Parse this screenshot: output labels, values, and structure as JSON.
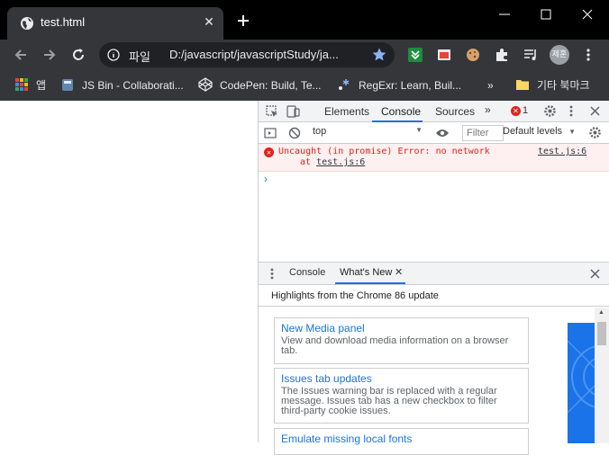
{
  "browser": {
    "tab_title": "test.html",
    "address_scheme": "파일",
    "address_url": "D:/javascript/javascriptStudy/ja...",
    "profile_label": "제훈"
  },
  "bookmarks": [
    {
      "label": "앱",
      "icon": "apps-grid-icon"
    },
    {
      "label": "JS Bin - Collaborati...",
      "icon": "jsbin-icon"
    },
    {
      "label": "CodePen: Build, Te...",
      "icon": "codepen-icon"
    },
    {
      "label": "RegExr: Learn, Buil...",
      "icon": "regexr-icon"
    }
  ],
  "bookmarks_overflow": "»",
  "other_bookmarks": "기타 북마크",
  "devtools": {
    "tabs": [
      "Elements",
      "Console",
      "Sources"
    ],
    "active_tab": "Console",
    "more_tabs": "»",
    "error_count": "1",
    "context": "top",
    "filter_placeholder": "Filter",
    "levels": "Default levels",
    "error": {
      "message": "Uncaught (in promise) Error: no network",
      "at_prefix": "at",
      "location": "test.js:6",
      "source": "test.js:6"
    },
    "prompt": "›",
    "drawer": {
      "tabs": [
        "Console",
        "What's New"
      ],
      "active_tab": "What's New",
      "header": "Highlights from the Chrome 86 update",
      "cards": [
        {
          "title": "New Media panel",
          "desc": "View and download media information on a browser tab."
        },
        {
          "title": "Issues tab updates",
          "desc": "The Issues warning bar is replaced with a regular message. Issues tab has a new checkbox to filter third-party cookie issues."
        },
        {
          "title": "Emulate missing local fonts",
          "desc": ""
        }
      ]
    }
  },
  "colors": {
    "accent": "#1a73e8",
    "error": "#e0231d",
    "tab_bg": "#35363a"
  }
}
